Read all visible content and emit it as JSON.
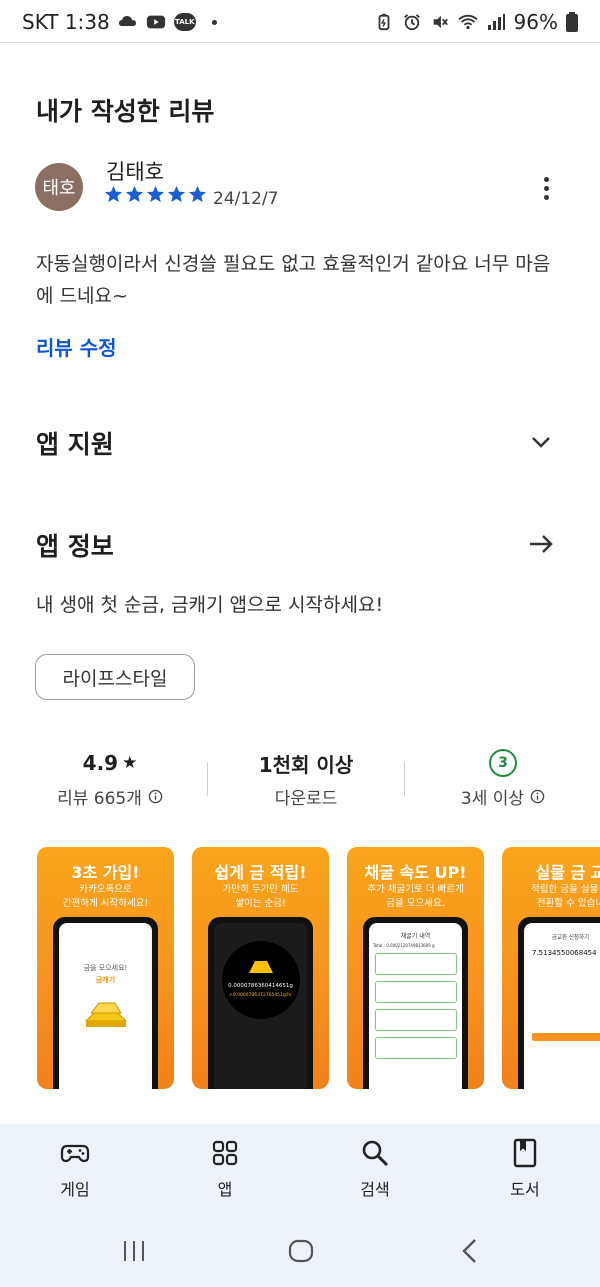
{
  "status_bar": {
    "carrier_time": "SKT 1:38",
    "talk_badge": "TALK",
    "battery": "96%",
    "icons": [
      "cloud-icon",
      "youtube-icon",
      "kakaotalk-icon",
      "dot-icon",
      "battery-saver-icon",
      "alarm-icon",
      "mute-icon",
      "wifi-icon",
      "signal-icon",
      "battery-icon"
    ]
  },
  "review": {
    "section_title": "내가 작성한 리뷰",
    "avatar_text": "태호",
    "reviewer_name": "김태호",
    "rating": 5,
    "date": "24/12/7",
    "text": "자동실행이라서 신경쓸  필요도 없고 효율적인거 같아요 너무 마음에 드네요~",
    "edit_label": "리뷰 수정"
  },
  "app_support": {
    "title": "앱 지원",
    "icon": "chevron-down-icon"
  },
  "app_info": {
    "title": "앱 정보",
    "icon": "arrow-right-icon",
    "description": "내 생애 첫 순금, 금캐기 앱으로 시작하세요!",
    "category_chip": "라이프스타일"
  },
  "stats": {
    "rating": "4.9",
    "rating_star": "★",
    "reviews": "리뷰 665개",
    "downloads": "1천회 이상",
    "downloads_label": "다운로드",
    "age_badge": "3",
    "age_label": "3세 이상"
  },
  "screenshots": [
    {
      "title": "3초 가입!",
      "subtitle": "카카오톡으로\n간편하게 시작하세요!",
      "screen_text": "금을 모으세요!",
      "screen_accent": "금캐기"
    },
    {
      "title": "쉽게 금 적립!",
      "subtitle": "가만히 두기만 해도\n쌓이는 순금!",
      "screen_text": "0.0000786360414651g",
      "screen_accent": "+0.0000786372765451g/hr"
    },
    {
      "title": "채굴 속도 UP!",
      "subtitle": "추가 채굴기로 더 빠르게\n금을 모으세요.",
      "screen_text": "채굴기 내역",
      "screen_accent": "Total : 0.0002120749813609 g"
    },
    {
      "title": "실물 금 교",
      "subtitle": "적립한 금을 실물 금\n전환할 수 있습니",
      "screen_text": "금교환 신청하기",
      "screen_accent": "7.5134550068454"
    }
  ],
  "bottom_nav": [
    {
      "label": "게임",
      "icon": "gamepad-icon"
    },
    {
      "label": "앱",
      "icon": "apps-grid-icon"
    },
    {
      "label": "검색",
      "icon": "search-icon"
    },
    {
      "label": "도서",
      "icon": "book-icon"
    }
  ],
  "colors": {
    "accent_blue": "#0b57d0",
    "star_blue": "#1a5fd0",
    "age_green": "#1e8e3e",
    "shot_orange": "#f7931e",
    "nav_bg": "#eef2f9"
  }
}
